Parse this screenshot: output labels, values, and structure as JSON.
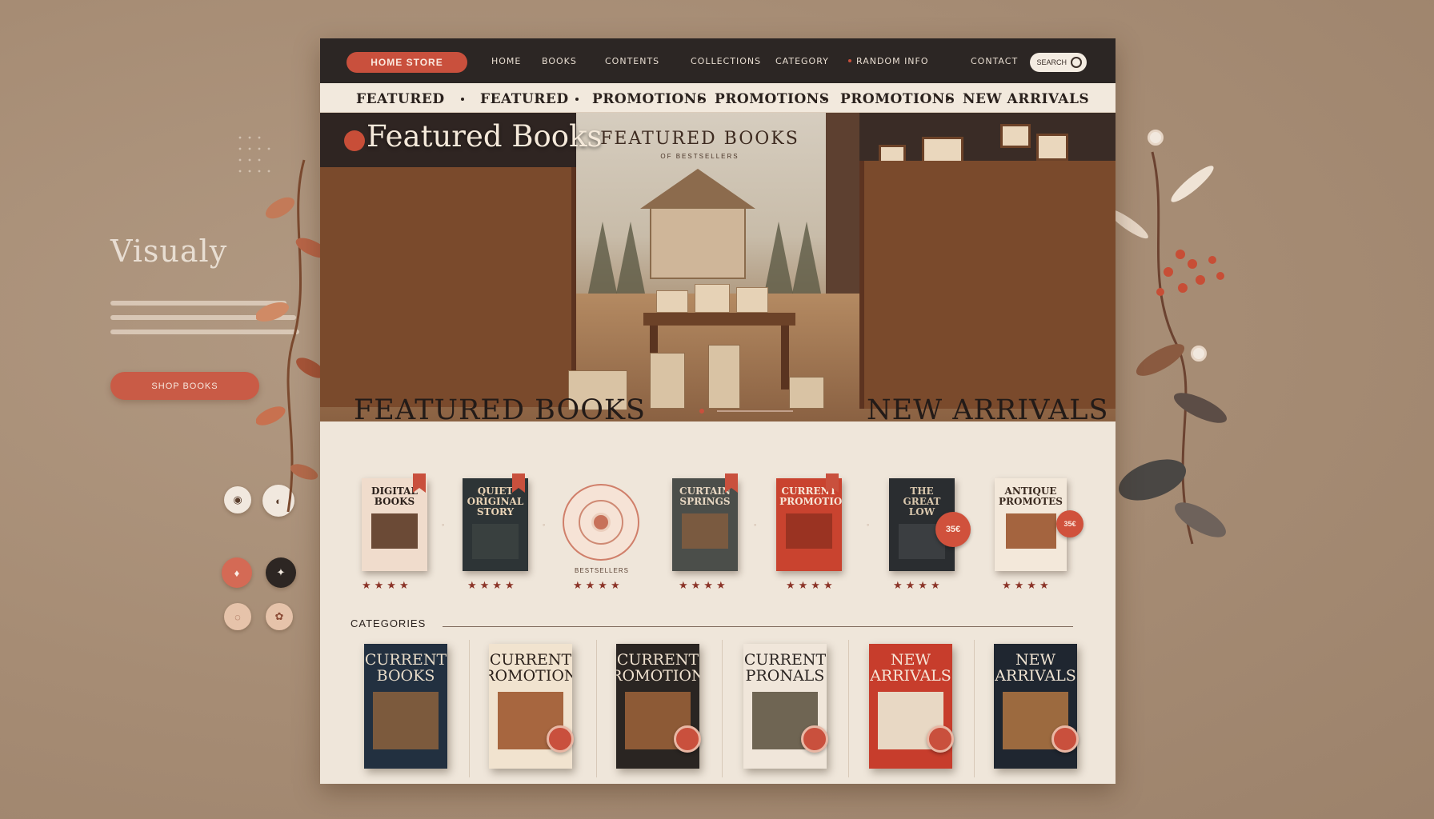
{
  "sidebar_left": {
    "heading": "Visualy",
    "cta_label": "SHOP BOOKS"
  },
  "topbar": {
    "logo": "HOME STORE",
    "nav": [
      "HOME",
      "BOOKS",
      "CONTENTS",
      "COLLECTIONS",
      "CATEGORY",
      "RANDOM INFO",
      "CONTACT"
    ],
    "search_label": "SEARCH"
  },
  "subnav": [
    "FEATURED",
    "FEATURED",
    "PROMOTIONS",
    "PROMOTIONS",
    "PROMOTIONS",
    "NEW ARRIVALS"
  ],
  "hero": {
    "title_left": "Featured Books",
    "title_center": "FEATURED BOOKS",
    "subtitle_center": "OF BESTSELLERS"
  },
  "featured": {
    "title_left": "FEATURED BOOKS",
    "title_right": "NEW ARRIVALS",
    "dial_caption": "BESTSELLERS",
    "books": [
      {
        "title": "DIGITAL BOOKS",
        "cover": "#f0dccc",
        "ink": "#2b201b",
        "art": "#6b4a36"
      },
      {
        "title": "QUIET ORIGINAL STORY",
        "cover": "#2d3436",
        "ink": "#e9d3b5",
        "art": "#39403f"
      },
      {
        "title": "CURTAIN SPRINGS",
        "cover": "#4b4e4a",
        "ink": "#e7d7c2",
        "art": "#7a5a40"
      },
      {
        "title": "CURRENT PROMOTIONS",
        "cover": "#c9432f",
        "ink": "#f6e5d6",
        "art": "#9a3322"
      },
      {
        "title": "THE GREAT LOW",
        "cover": "#2a2d30",
        "ink": "#d9c7ad",
        "art": "#3b3e41"
      },
      {
        "title": "ANTIQUE PROMOTES",
        "cover": "#f3e8da",
        "ink": "#3a2a20",
        "art": "#a4643f"
      }
    ],
    "price_badges": [
      "35€",
      "35€"
    ],
    "ratings": [
      "★★★★",
      "★★★★",
      "★★★★",
      "★★★★",
      "★★★★",
      "★★★★",
      "★★★★"
    ]
  },
  "categories": {
    "label": "CATEGORIES",
    "books": [
      {
        "title": "CURRENT BOOKS",
        "cover": "#223040",
        "ink": "#e8dcc9",
        "art": "#7c5a3d"
      },
      {
        "title": "CURRENT PROMOTIONS",
        "cover": "#f1e3cf",
        "ink": "#2c211b",
        "art": "#a7663f"
      },
      {
        "title": "CURRENT PROMOTIONS",
        "cover": "#2a2522",
        "ink": "#efe1cf",
        "art": "#8d5a36"
      },
      {
        "title": "CURRENT PRONALS",
        "cover": "#f0e6da",
        "ink": "#2b2522",
        "art": "#6f6553"
      },
      {
        "title": "NEW ARRIVALS",
        "cover": "#c73d2c",
        "ink": "#f6e6d8",
        "art": "#e8d8c4"
      },
      {
        "title": "NEW ARRIVALS",
        "cover": "#1f2630",
        "ink": "#efe3d2",
        "art": "#9c6a3f"
      }
    ]
  },
  "colors": {
    "accent": "#c9503d",
    "dark": "#2c2624",
    "paper": "#efe6da",
    "background": "#a88f78"
  }
}
